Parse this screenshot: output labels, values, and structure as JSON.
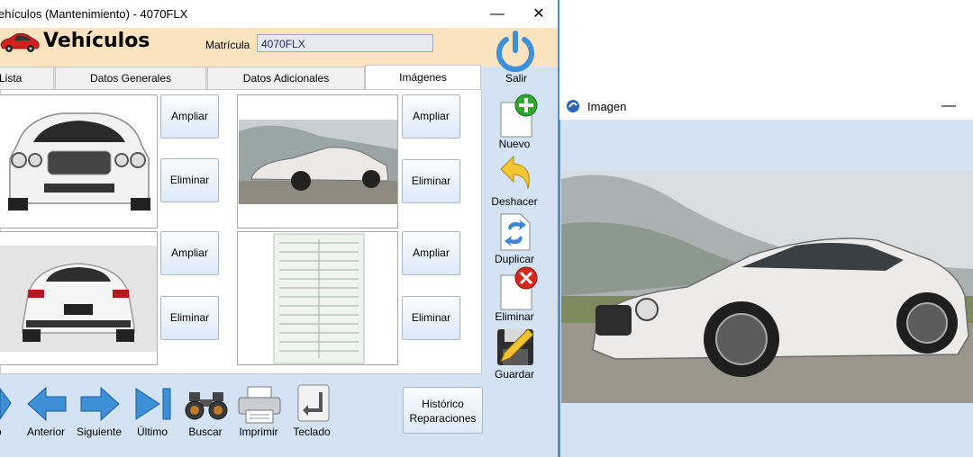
{
  "main_window": {
    "title": "ehículos (Mantenimiento) - 4070FLX",
    "form_title": "Vehículos",
    "plate_label": "Matrícula",
    "plate_value": "4070FLX",
    "exit_label": "Salir",
    "tabs": [
      {
        "label": "Lista"
      },
      {
        "label": "Datos Generales"
      },
      {
        "label": "Datos Adicionales"
      },
      {
        "label": "Imágenes",
        "active": true
      }
    ],
    "images": {
      "enlarge_label": "Ampliar",
      "delete_label": "Eliminar"
    },
    "toolbar": {
      "new_label": "Nuevo",
      "undo_label": "Deshacer",
      "duplicate_label": "Duplicar",
      "delete_label": "Eliminar",
      "save_label": "Guardar"
    },
    "nav": {
      "first_label": "ero",
      "previous_label": "Anterior",
      "next_label": "Siguiente",
      "last_label": "Último",
      "search_label": "Buscar",
      "print_label": "Imprimir",
      "keyboard_label": "Teclado"
    },
    "history_button": "Histórico\nReparaciones"
  },
  "image_window": {
    "title": "Imagen"
  },
  "icons": [
    "red-car-logo-icon",
    "power-icon",
    "new-document-icon",
    "undo-arrow-icon",
    "duplicate-icon",
    "delete-document-icon",
    "save-pencil-icon",
    "first-record-icon",
    "previous-arrow-icon",
    "next-arrow-icon",
    "last-record-icon",
    "binoculars-icon",
    "printer-icon",
    "keyboard-enter-icon",
    "app-logo-icon"
  ],
  "colors": {
    "header_bg": "#fbe3c0",
    "panel_bg": "#d4e3f4",
    "accent_blue": "#3c8fd8",
    "window_border": "#4d8fcf"
  }
}
